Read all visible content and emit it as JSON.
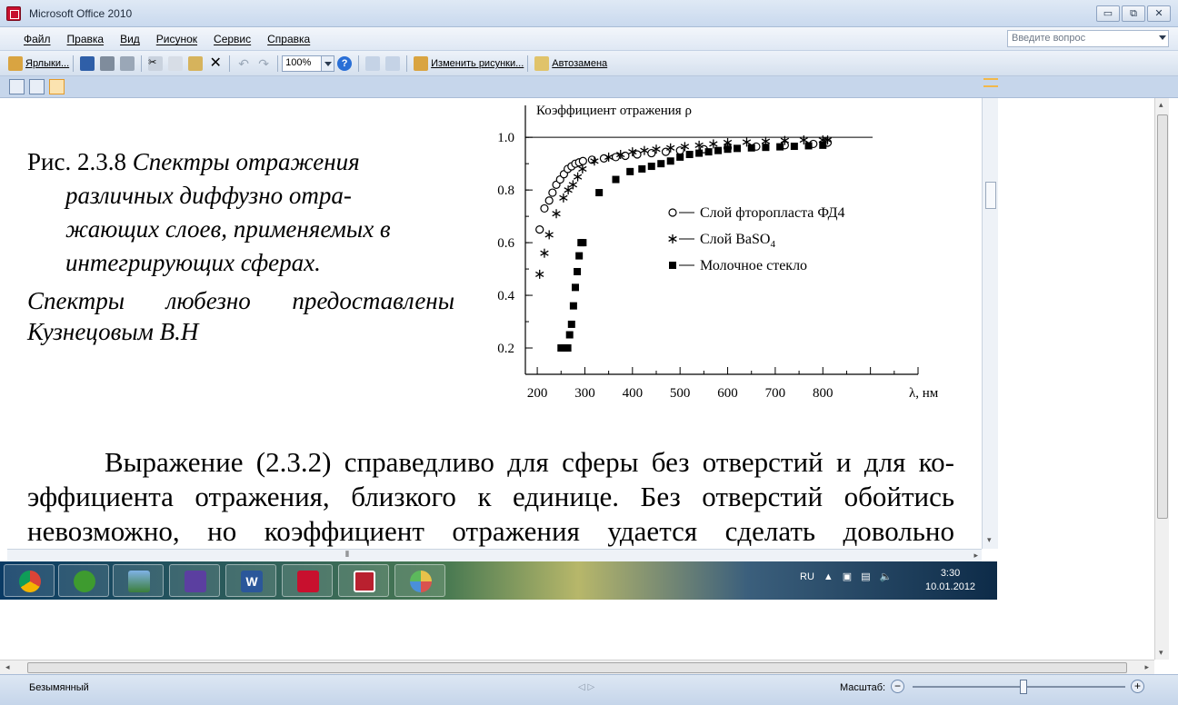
{
  "window": {
    "title": "Microsoft Office 2010",
    "controls": [
      "▭",
      "⧉",
      "✕"
    ]
  },
  "menu": {
    "items": [
      "Файл",
      "Правка",
      "Вид",
      "Рисунок",
      "Сервис",
      "Справка"
    ],
    "help_placeholder": "Введите вопрос"
  },
  "toolbar": {
    "labels_button": "Ярлыки...",
    "zoom": "100%",
    "edit_pictures": "Изменить рисунки...",
    "autocorrect": "Автозамена"
  },
  "document": {
    "caption_prefix": "Рис. 2.3.8",
    "caption_line1": "Спектры отражения",
    "caption_line2": "различных диффузно отра-",
    "caption_line3": "жающих слоев, применяемых в",
    "caption_line4": "интегрирующих сферах.",
    "credit_line1": "Спектры любезно предоставлены",
    "credit_line2": "Кузнецовым В.Н",
    "body_line1": "Выражение (2.3.2) справедливо для сферы без отверстий и для ко-",
    "body_line2": "эффициента отражения, близкого к единице. Без отверстий обойтись",
    "body_line3": "невозможно, но коэффициент отражения удается сделать довольно"
  },
  "chart_data": {
    "type": "scatter",
    "title": "Коэффициент отражения ρ",
    "xlabel": "λ, нм",
    "ylabel": "",
    "xlim": [
      175,
      1000
    ],
    "ylim": [
      0.1,
      1.08
    ],
    "x_ticks": [
      200,
      300,
      400,
      500,
      600,
      700,
      800
    ],
    "y_ticks": [
      0.2,
      0.4,
      0.6,
      0.8,
      1.0
    ],
    "y_tick_labels": [
      "0.2",
      "0.4",
      "0.6",
      "0.8",
      "1.0"
    ],
    "reference_line_y": 1.0,
    "legend_position": "right",
    "series": [
      {
        "name": "Слой фторопласта ФД4",
        "marker": "circle-open",
        "x": [
          205,
          215,
          225,
          232,
          240,
          248,
          256,
          264,
          272,
          280,
          288,
          296,
          315,
          340,
          365,
          385,
          410,
          440,
          470,
          500,
          550,
          600,
          660,
          720,
          780,
          810
        ],
        "y": [
          0.65,
          0.73,
          0.76,
          0.79,
          0.82,
          0.84,
          0.86,
          0.88,
          0.89,
          0.9,
          0.905,
          0.91,
          0.915,
          0.92,
          0.925,
          0.93,
          0.935,
          0.94,
          0.945,
          0.95,
          0.955,
          0.96,
          0.965,
          0.97,
          0.975,
          0.98
        ]
      },
      {
        "name": "Слой BaSO",
        "name_subscript": "4",
        "marker": "asterisk",
        "x": [
          205,
          215,
          225,
          240,
          255,
          265,
          275,
          285,
          295,
          320,
          350,
          375,
          400,
          425,
          450,
          480,
          510,
          540,
          570,
          600,
          640,
          680,
          720,
          760,
          800,
          810
        ],
        "y": [
          0.48,
          0.56,
          0.63,
          0.71,
          0.77,
          0.8,
          0.82,
          0.85,
          0.88,
          0.91,
          0.925,
          0.935,
          0.945,
          0.95,
          0.955,
          0.96,
          0.965,
          0.97,
          0.975,
          0.98,
          0.982,
          0.985,
          0.988,
          0.99,
          0.99,
          0.99
        ]
      },
      {
        "name": "Молочное стекло",
        "marker": "square-filled",
        "x": [
          250,
          258,
          264,
          268,
          272,
          276,
          280,
          284,
          288,
          292,
          296,
          330,
          365,
          395,
          420,
          440,
          460,
          480,
          500,
          520,
          540,
          560,
          580,
          600,
          620,
          650,
          680,
          710,
          740,
          770,
          800
        ],
        "y": [
          0.2,
          0.2,
          0.2,
          0.25,
          0.29,
          0.36,
          0.43,
          0.49,
          0.55,
          0.6,
          0.6,
          0.79,
          0.84,
          0.87,
          0.88,
          0.89,
          0.9,
          0.91,
          0.925,
          0.935,
          0.94,
          0.945,
          0.95,
          0.955,
          0.958,
          0.96,
          0.962,
          0.964,
          0.966,
          0.968,
          0.97
        ]
      }
    ]
  },
  "taskbar": {
    "apps": [
      "Chrome",
      "uTorrent",
      "Picture Manager",
      "Notepad",
      "Word",
      "Acrobat",
      "Office",
      "Paint"
    ],
    "language": "RU",
    "time": "3:30",
    "date": "10.01.2012"
  },
  "status": {
    "file_name": "Безымянный",
    "zoom_label": "Масштаб:",
    "zoom_level": 0.52
  },
  "colors": {
    "ribbon_blue": "#c6d6eb",
    "app_red": "#c8102e"
  }
}
